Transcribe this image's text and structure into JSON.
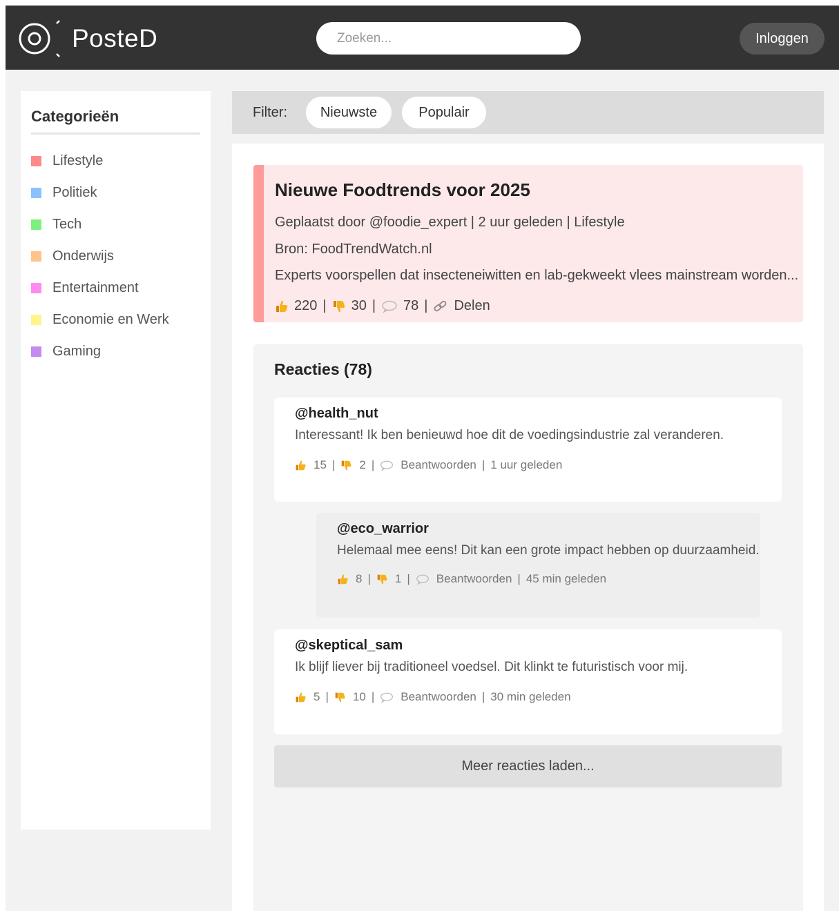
{
  "header": {
    "app_name": "PosteD",
    "search_placeholder": "Zoeken...",
    "login_label": "Inloggen",
    "background": "#333333"
  },
  "sidebar": {
    "title": "Categorieën",
    "categories": [
      {
        "label": "Lifestyle",
        "color": "#ff8a8a"
      },
      {
        "label": "Politiek",
        "color": "#8ac2ff"
      },
      {
        "label": "Tech",
        "color": "#7cf07c"
      },
      {
        "label": "Onderwijs",
        "color": "#ffc38a"
      },
      {
        "label": "Entertainment",
        "color": "#ff8af0"
      },
      {
        "label": "Economie en Werk",
        "color": "#fff58a"
      },
      {
        "label": "Gaming",
        "color": "#c58af0"
      }
    ]
  },
  "filter": {
    "label": "Filter:",
    "options": [
      "Nieuwste",
      "Populair"
    ]
  },
  "post": {
    "title": "Nieuwe Foodtrends voor 2025",
    "meta": "Geplaatst door @foodie_expert | 2 uur geleden | Lifestyle",
    "source": "Bron: FoodTrendWatch.nl",
    "excerpt": "Experts voorspellen dat insecteneiwitten en lab-gekweekt vlees mainstream worden...",
    "likes": "220",
    "dislikes": "30",
    "comments": "78",
    "share_label": "Delen",
    "accent_color": "#ff9b9b"
  },
  "reactions": {
    "title": "Reacties (78)",
    "items": [
      {
        "user": "@health_nut",
        "text": "Interessant! Ik ben benieuwd hoe dit de voedingsindustrie zal veranderen.",
        "likes": "15",
        "dislikes": "2",
        "reply_label": "Beantwoorden",
        "time": "1 uur geleden"
      },
      {
        "user": "@eco_warrior",
        "text": "Helemaal mee eens! Dit kan een grote impact hebben op duurzaamheid.",
        "likes": "8",
        "dislikes": "1",
        "reply_label": "Beantwoorden",
        "time": "45 min geleden"
      },
      {
        "user": "@skeptical_sam",
        "text": "Ik blijf liever bij traditioneel voedsel. Dit klinkt te futuristisch voor mij.",
        "likes": "5",
        "dislikes": "10",
        "reply_label": "Beantwoorden",
        "time": "30 min geleden"
      }
    ],
    "load_more_label": "Meer reacties laden..."
  }
}
